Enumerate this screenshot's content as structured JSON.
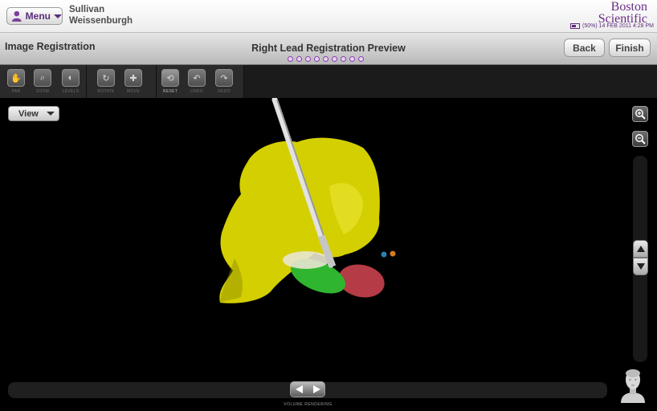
{
  "header": {
    "menu_label": "Menu",
    "patient_first": "Sullivan",
    "patient_last": "Weissenburgh",
    "logo_line1": "Boston",
    "logo_line2": "Scientific",
    "status_text": "(50%) 14 FEB 2011 4:28 PM",
    "battery_percent": 50
  },
  "titlebar": {
    "section_title": "Image Registration",
    "preview_title": "Right Lead Registration Preview",
    "step_dots": 9,
    "back_label": "Back",
    "finish_label": "Finish"
  },
  "toolbar": {
    "tools": [
      {
        "label": "PAN",
        "icon": "hand-icon",
        "active": false
      },
      {
        "label": "ZOOM",
        "icon": "magnifier-icon",
        "active": false
      },
      {
        "label": "LEVELS",
        "icon": "levels-icon",
        "active": false
      },
      {
        "label": "ROTATE",
        "icon": "rotate-icon",
        "active": false
      },
      {
        "label": "MOVE",
        "icon": "move-icon",
        "active": false
      },
      {
        "label": "RESET",
        "icon": "reset-icon",
        "active": true
      },
      {
        "label": "UNDO",
        "icon": "undo-icon",
        "active": false
      },
      {
        "label": "REDO",
        "icon": "redo-icon",
        "active": false
      }
    ]
  },
  "viewport": {
    "view_label": "View",
    "mode_label": "VOLUME RENDERING",
    "colors": {
      "volume": "#d4cf00",
      "lead": "#dcdcdc",
      "green_region": "#2fb52f",
      "red_region": "#b53b46",
      "marker_blue": "#2b7fb3",
      "marker_orange": "#d57d1e"
    }
  }
}
